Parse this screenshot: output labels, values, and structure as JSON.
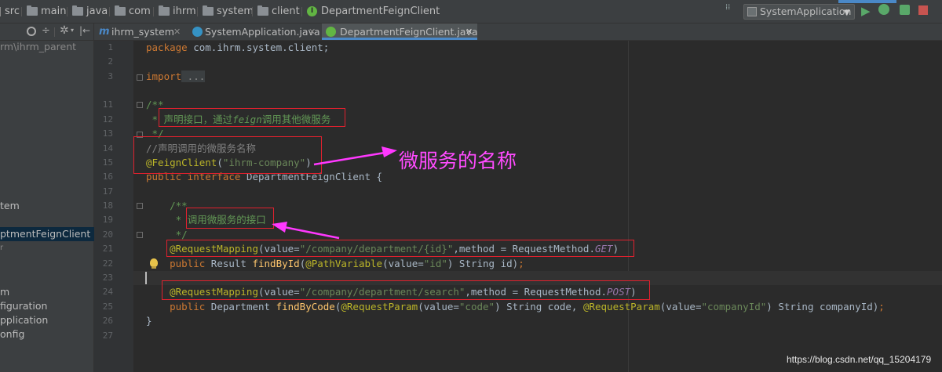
{
  "breadcrumb": [
    "src",
    "main",
    "java",
    "com",
    "ihrm",
    "system",
    "client",
    "DepartmentFeignClient"
  ],
  "run_config": "SystemApplication",
  "tabs": [
    {
      "label": "ihrm_system",
      "icon": "m"
    },
    {
      "label": "SystemApplication.java",
      "icon": "c"
    },
    {
      "label": "DepartmentFeignClient.java",
      "icon": "i"
    }
  ],
  "project_panel": {
    "root": "rm\\ihrm_parent",
    "items": [
      "tem",
      "ptmentFeignClient",
      "m",
      "figuration",
      "pplication",
      "onfig"
    ]
  },
  "line_numbers": [
    "1",
    "2",
    "3",
    "",
    "11",
    "12",
    "13",
    "14",
    "15",
    "16",
    "17",
    "18",
    "19",
    "20",
    "21",
    "22",
    "23",
    "24",
    "25",
    "26",
    "27"
  ],
  "code": {
    "l1_kw": "package",
    "l1_rest": " com.ihrm.system.client;",
    "l3_kw": "import",
    "l3_rest": " ...",
    "l11": "/**",
    "l12_star": " * ",
    "l12_a": "声明接口，通过",
    "l12_b": "feign",
    "l12_c": "调用其他微服务",
    "l13": " */",
    "l14": "//声明调用的微服务名称",
    "l15_ann": "@FeignClient",
    "l15_open": "(",
    "l15_str": "\"ihrm-company\"",
    "l15_close": ")",
    "l16_kw": "public interface",
    "l16_rest": " DepartmentFeignClient {",
    "l18": "    /**",
    "l19_star": "     * ",
    "l19_text": "调用微服务的接口",
    "l20": "     */",
    "l21_ann": "    @RequestMapping",
    "l21_a": "(value=",
    "l21_str": "\"/company/department/{id}\"",
    "l21_b": ",method = RequestMethod.",
    "l21_get": "GET",
    "l21_c": ")",
    "l22_kw": "    public",
    "l22_a": " Result ",
    "l22_fn": "findById",
    "l22_b": "(",
    "l22_ann": "@PathVariable",
    "l22_c": "(value=",
    "l22_str": "\"id\"",
    "l22_d": ") String id)",
    "l22_semi": ";",
    "l24_ann": "    @RequestMapping",
    "l24_a": "(value=",
    "l24_str": "\"/company/department/search\"",
    "l24_b": ",method = RequestMethod.",
    "l24_post": "POST",
    "l24_c": ")",
    "l25_kw": "    public",
    "l25_a": " Department ",
    "l25_fn": "findByCode",
    "l25_b": "(",
    "l25_ann1": "@RequestParam",
    "l25_c": "(value=",
    "l25_str1": "\"code\"",
    "l25_d": ") String code, ",
    "l25_ann2": "@RequestParam",
    "l25_e": "(value=",
    "l25_str2": "\"companyId\"",
    "l25_f": ") String companyId)",
    "l25_semi": ";",
    "l26": "}"
  },
  "annotation_label": "微服务的名称",
  "watermark": "https://blog.csdn.net/qq_15204179",
  "colors": {
    "annotation_red": "#e0212e",
    "arrow_magenta": "#ff38ff",
    "label_magenta": "#ff4bff"
  }
}
